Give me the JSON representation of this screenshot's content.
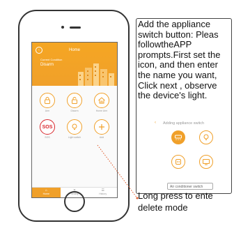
{
  "app": {
    "header_title": "Home",
    "condition_label": "Current Condition",
    "location": "Disarm"
  },
  "tiles": [
    {
      "label": "Arm",
      "icon": "lock-closed-icon"
    },
    {
      "label": "Disarm",
      "icon": "lock-open-icon"
    },
    {
      "label": "Home Arm",
      "icon": "home-icon"
    },
    {
      "label": "SOS",
      "icon": "sos-icon",
      "text": "SOS"
    },
    {
      "label": "Light switch",
      "icon": "lightbulb-icon"
    },
    {
      "label": "Add",
      "icon": "plus-icon"
    }
  ],
  "tabs": [
    {
      "label": "Home",
      "icon": "home-tab-icon",
      "active": true
    },
    {
      "label": "Setting",
      "icon": "settings-tab-icon",
      "active": false
    },
    {
      "label": "History",
      "icon": "history-tab-icon",
      "active": false
    }
  ],
  "instructions": "Add the appliance\nswitch button: Pleas\nfollowtheAPP\nprompts.First set the\nicon, and then enter\nthe name you want,\nClick  next , observe\nthe device's light.",
  "appliance_panel": {
    "title": "Adding appliance switch",
    "input_value": "Air conditioner switch",
    "icons": [
      "air-conditioner-icon",
      "lightbulb-icon",
      "socket-icon",
      "tv-icon"
    ]
  },
  "caption": "Long press to ente\ndelete mode",
  "colors": {
    "accent": "#f0a02a",
    "sos": "#d9262b"
  }
}
